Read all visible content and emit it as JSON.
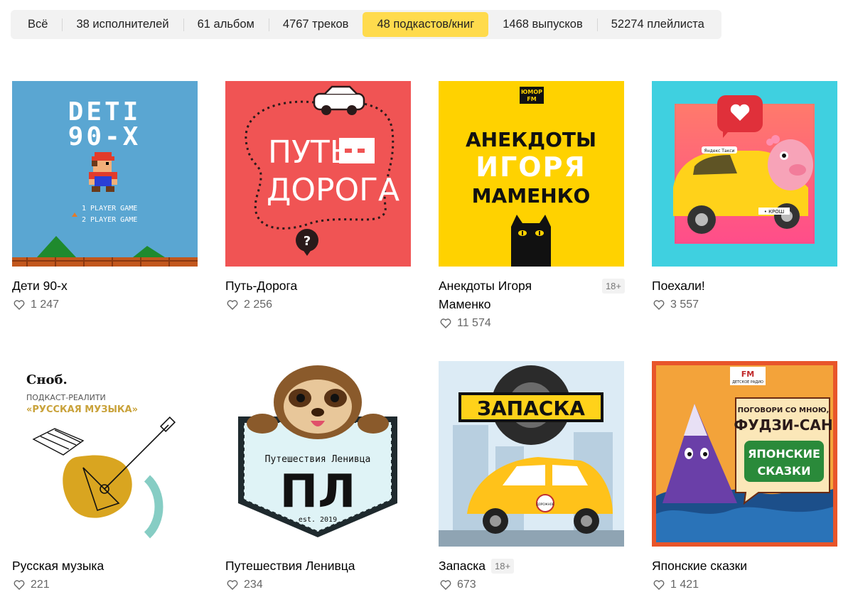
{
  "tabs": [
    {
      "label": "Всё",
      "active": false
    },
    {
      "label": "38 исполнителей",
      "active": false
    },
    {
      "label": "61 альбом",
      "active": false
    },
    {
      "label": "4767 треков",
      "active": false
    },
    {
      "label": "48 подкастов/книг",
      "active": true
    },
    {
      "label": "1468 выпусков",
      "active": false
    },
    {
      "label": "52274 плейлиста",
      "active": false
    }
  ],
  "cards": [
    {
      "title": "Дети 90-х",
      "likes": "1 247",
      "cover": {
        "line1": "DETI",
        "line2": "90-X",
        "menu1": "1 PLAYER GAME",
        "menu2": "2 PLAYER GAME"
      }
    },
    {
      "title": "Путь-Дорога",
      "likes": "2 256",
      "cover": {
        "line1": "ПУТЬ",
        "line2": "ДОРОГА",
        "mark": "?"
      }
    },
    {
      "title": "Анекдоты Игоря Маменко",
      "likes": "11 574",
      "badge": "18+",
      "cover": {
        "logo1": "ЮМОР",
        "logo2": "FM",
        "line1": "АНЕКДОТЫ",
        "line2": "ИГОРЯ",
        "line3": "МАМЕНКО"
      }
    },
    {
      "title": "Поехали!",
      "likes": "3 557",
      "cover": {
        "roof": "Яндекс Такси",
        "plate": "• КРОШ"
      }
    },
    {
      "title": "Русская музыка",
      "likes": "221",
      "cover": {
        "brand": "Сноб.",
        "kicker": "ПОДКАСТ-РЕАЛИТИ",
        "headline": "«РУССКАЯ МУЗЫКА»"
      }
    },
    {
      "title": "Путешествия Ленивца",
      "likes": "234",
      "cover": {
        "caption": "Путешествия Ленивца",
        "monogram": "ПЛ",
        "est": "est. 2019"
      }
    },
    {
      "title": "Запаска",
      "likes": "673",
      "badge": "18+",
      "cover": {
        "headline": "ЗАПАСКА",
        "door": "ДОРОЖНОЕ"
      }
    },
    {
      "title": "Японские сказки",
      "likes": "1 421",
      "cover": {
        "logo": "FM",
        "logo_sub": "ДЕТСКОЕ РАДИО",
        "line1": "ПОГОВОРИ СО МНОЮ,",
        "line2": "ФУДЗИ-САН",
        "line3": "ЯПОНСКИЕ",
        "line4": "СКАЗКИ"
      }
    }
  ],
  "icons": {
    "like": "heart-outline-icon"
  },
  "colors": {
    "accent": "#ffdb4d",
    "tab_bg": "#f2f2f2",
    "likes_text": "#666666"
  }
}
